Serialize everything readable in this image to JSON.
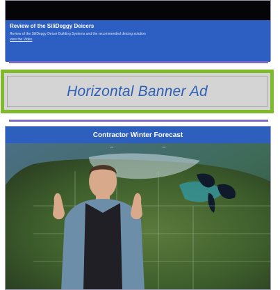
{
  "top_card": {
    "title": "Review of the SiliDeggy Deicers",
    "description": "Review of the SiliDeggy Deicer Building Systems and the recommended deicing solution",
    "link_label": "view the Video"
  },
  "banner": {
    "text": "Horizontal Banner Ad"
  },
  "forecast": {
    "title": "Contractor Winter Forecast",
    "map_label_left": "...",
    "map_label_right": "..."
  },
  "colors": {
    "ad_border": "#7fb92c",
    "ad_background": "#d4d4d4",
    "ad_text": "#2c5fb5",
    "header_blue": "#2c5fbe",
    "divider_purple": "#7c6bc0"
  }
}
